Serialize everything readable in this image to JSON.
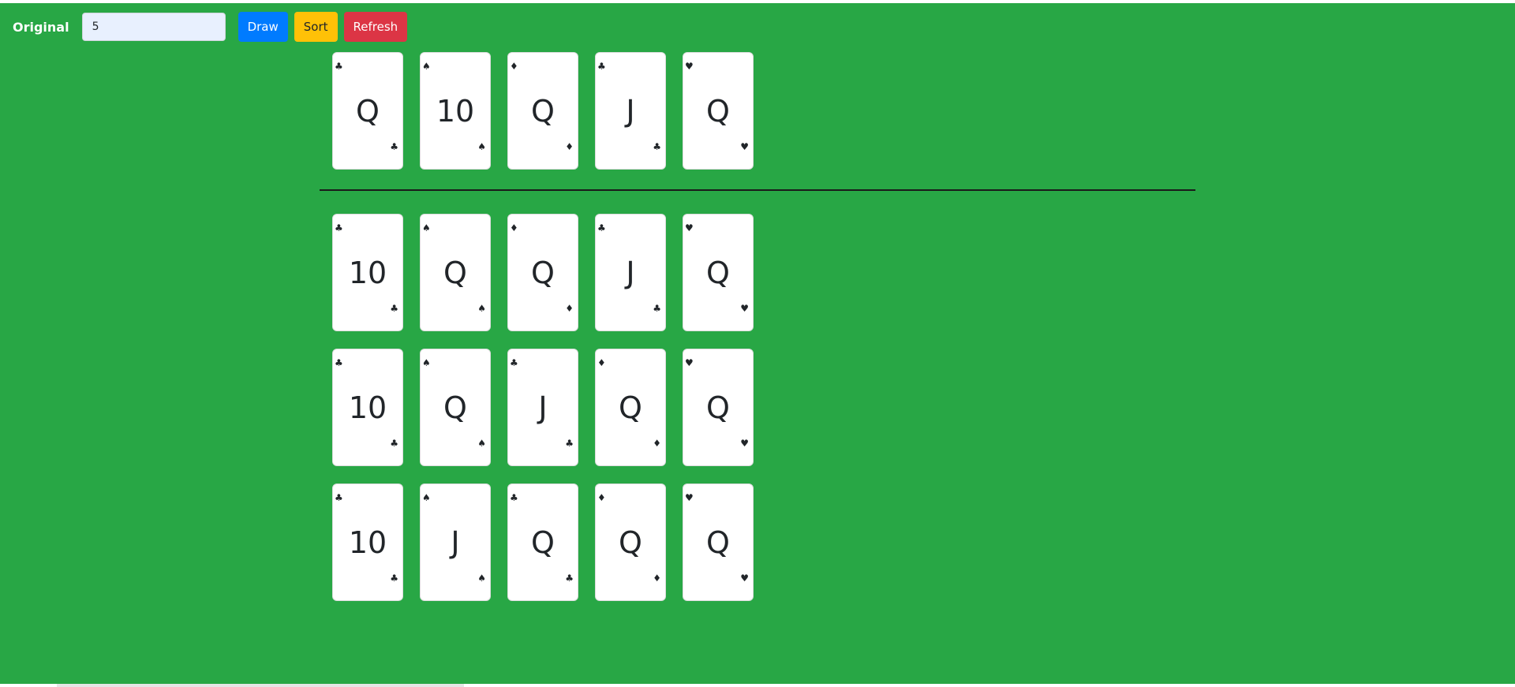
{
  "toolbar": {
    "label": "Original",
    "count_value": "5",
    "draw_label": "Draw",
    "sort_label": "Sort",
    "refresh_label": "Refresh"
  },
  "rows": [
    [
      {
        "rank": "Q",
        "suit": "♣"
      },
      {
        "rank": "10",
        "suit": "♠"
      },
      {
        "rank": "Q",
        "suit": "♦"
      },
      {
        "rank": "J",
        "suit": "♣"
      },
      {
        "rank": "Q",
        "suit": "♥"
      }
    ],
    [
      {
        "rank": "10",
        "suit": "♣"
      },
      {
        "rank": "Q",
        "suit": "♠"
      },
      {
        "rank": "Q",
        "suit": "♦"
      },
      {
        "rank": "J",
        "suit": "♣"
      },
      {
        "rank": "Q",
        "suit": "♥"
      }
    ],
    [
      {
        "rank": "10",
        "suit": "♣"
      },
      {
        "rank": "Q",
        "suit": "♠"
      },
      {
        "rank": "J",
        "suit": "♣"
      },
      {
        "rank": "Q",
        "suit": "♦"
      },
      {
        "rank": "Q",
        "suit": "♥"
      }
    ],
    [
      {
        "rank": "10",
        "suit": "♣"
      },
      {
        "rank": "J",
        "suit": "♠"
      },
      {
        "rank": "Q",
        "suit": "♣"
      },
      {
        "rank": "Q",
        "suit": "♦"
      },
      {
        "rank": "Q",
        "suit": "♥"
      }
    ]
  ],
  "colors": {
    "table_green": "#28a745",
    "draw_blue": "#007bff",
    "sort_yellow": "#ffc107",
    "refresh_red": "#dc3545"
  }
}
